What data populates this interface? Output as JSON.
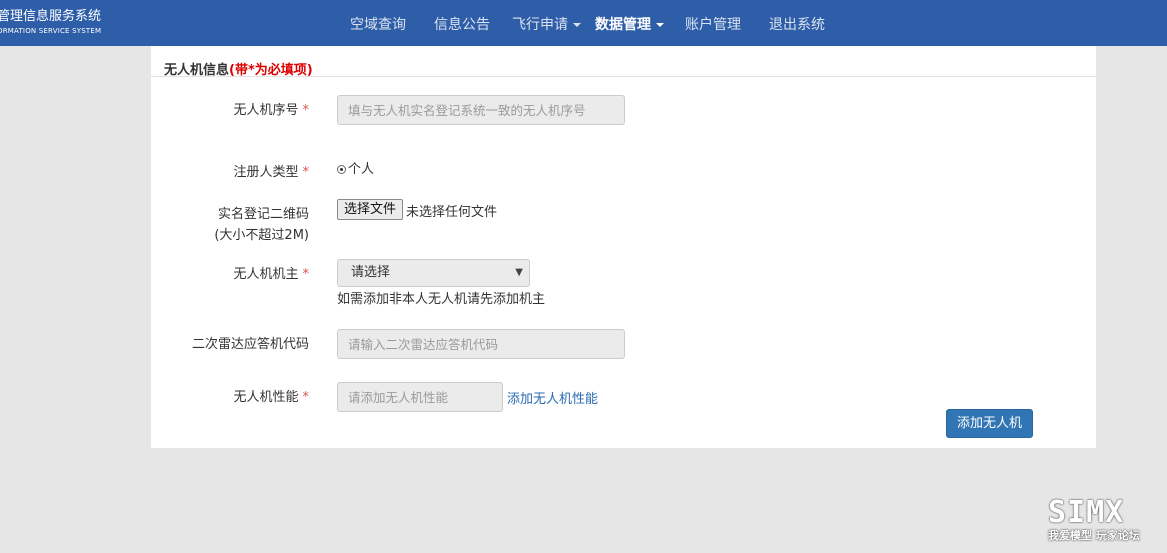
{
  "brand": {
    "title_cn": "管理信息服务系统",
    "title_en": "ORMATION SERVICE SYSTEM"
  },
  "nav": {
    "items": [
      {
        "label": "空域查询"
      },
      {
        "label": "信息公告"
      },
      {
        "label": "飞行申请"
      },
      {
        "label": "数据管理"
      },
      {
        "label": "账户管理"
      },
      {
        "label": "退出系统"
      }
    ],
    "active": "数据管理"
  },
  "panel": {
    "title": "无人机信息",
    "title_note": "(带*为必填项)"
  },
  "form": {
    "serial": {
      "label": "无人机序号",
      "star": "*",
      "placeholder": "填与无人机实名登记系统一致的无人机序号"
    },
    "registrant": {
      "label": "注册人类型",
      "star": "*",
      "option": "个人"
    },
    "qrcode": {
      "label_line1": "实名登记二维码",
      "label_line2": "(大小不超过2M)",
      "button": "选择文件",
      "status": "未选择任何文件"
    },
    "owner": {
      "label": "无人机机主",
      "star": "*",
      "selected": "请选择",
      "hint": "如需添加非本人无人机请先添加机主"
    },
    "transponder": {
      "label": "二次雷达应答机代码",
      "placeholder": "请输入二次雷达应答机代码"
    },
    "performance": {
      "label": "无人机性能",
      "star": "*",
      "placeholder": "请添加无人机性能",
      "link": "添加无人机性能"
    },
    "submit": "添加无人机"
  },
  "watermark": {
    "big": "SIMX",
    "small": "我爱模型 玩家论坛"
  },
  "colors": {
    "header": "#2f5ea9",
    "primary_button": "#3175b4",
    "required": "#d00000",
    "link": "#2a6ab0",
    "background": "#e6e6e6"
  },
  "icons": {
    "dropdown_caret": "caret-down-icon",
    "select_arrow": "triangle-down-icon",
    "radio": "radio-icon"
  }
}
